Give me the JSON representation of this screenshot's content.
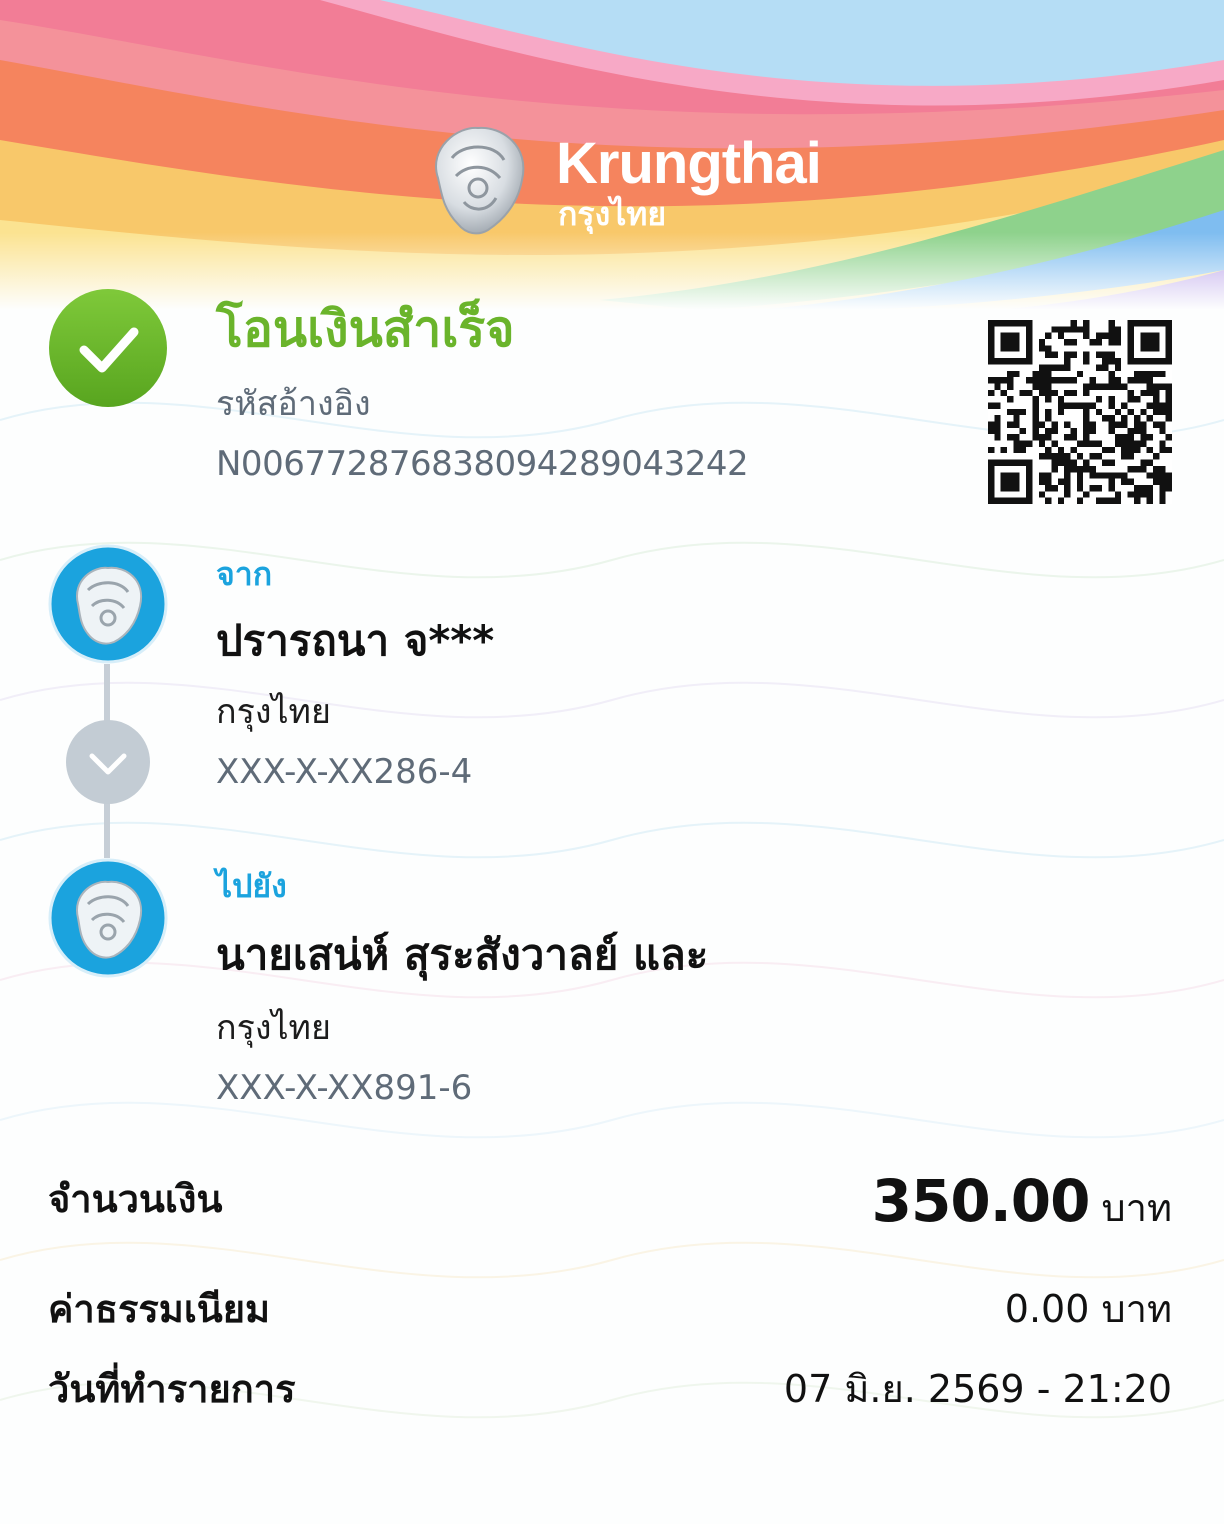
{
  "brand": {
    "name_en": "Krungthai",
    "name_th": "กรุงไทย"
  },
  "status": {
    "title": "โอนเงินสำเร็จ",
    "reference_label": "รหัสอ้างอิง",
    "reference_value": "N006772876838094289043242"
  },
  "sender": {
    "label": "จาก",
    "name": "ปรารถนา จ***",
    "bank": "กรุงไทย",
    "account": "XXX-X-XX286-4"
  },
  "receiver": {
    "label": "ไปยัง",
    "name": "นายเสน่ห์ สุระสังวาลย์ และ",
    "bank": "กรุงไทย",
    "account": "XXX-X-XX891-6"
  },
  "summary": {
    "amount_label": "จำนวนเงิน",
    "amount_value": "350.00",
    "amount_unit": "บาท",
    "fee_label": "ค่าธรรมเนียม",
    "fee_value": "0.00 บาท",
    "date_label": "วันที่ทำรายการ",
    "date_value": "07 มิ.ย. 2569 - 21:20"
  },
  "icons": {
    "success": "check-circle-icon",
    "bank": "krungthai-garuda-icon",
    "arrow": "chevron-down-icon",
    "qr": "qr-code"
  },
  "colors": {
    "success_green": "#6ab42b",
    "label_blue": "#1ba3de",
    "bank_blue": "#1ba3de",
    "muted_gray": "#5f6b78"
  }
}
